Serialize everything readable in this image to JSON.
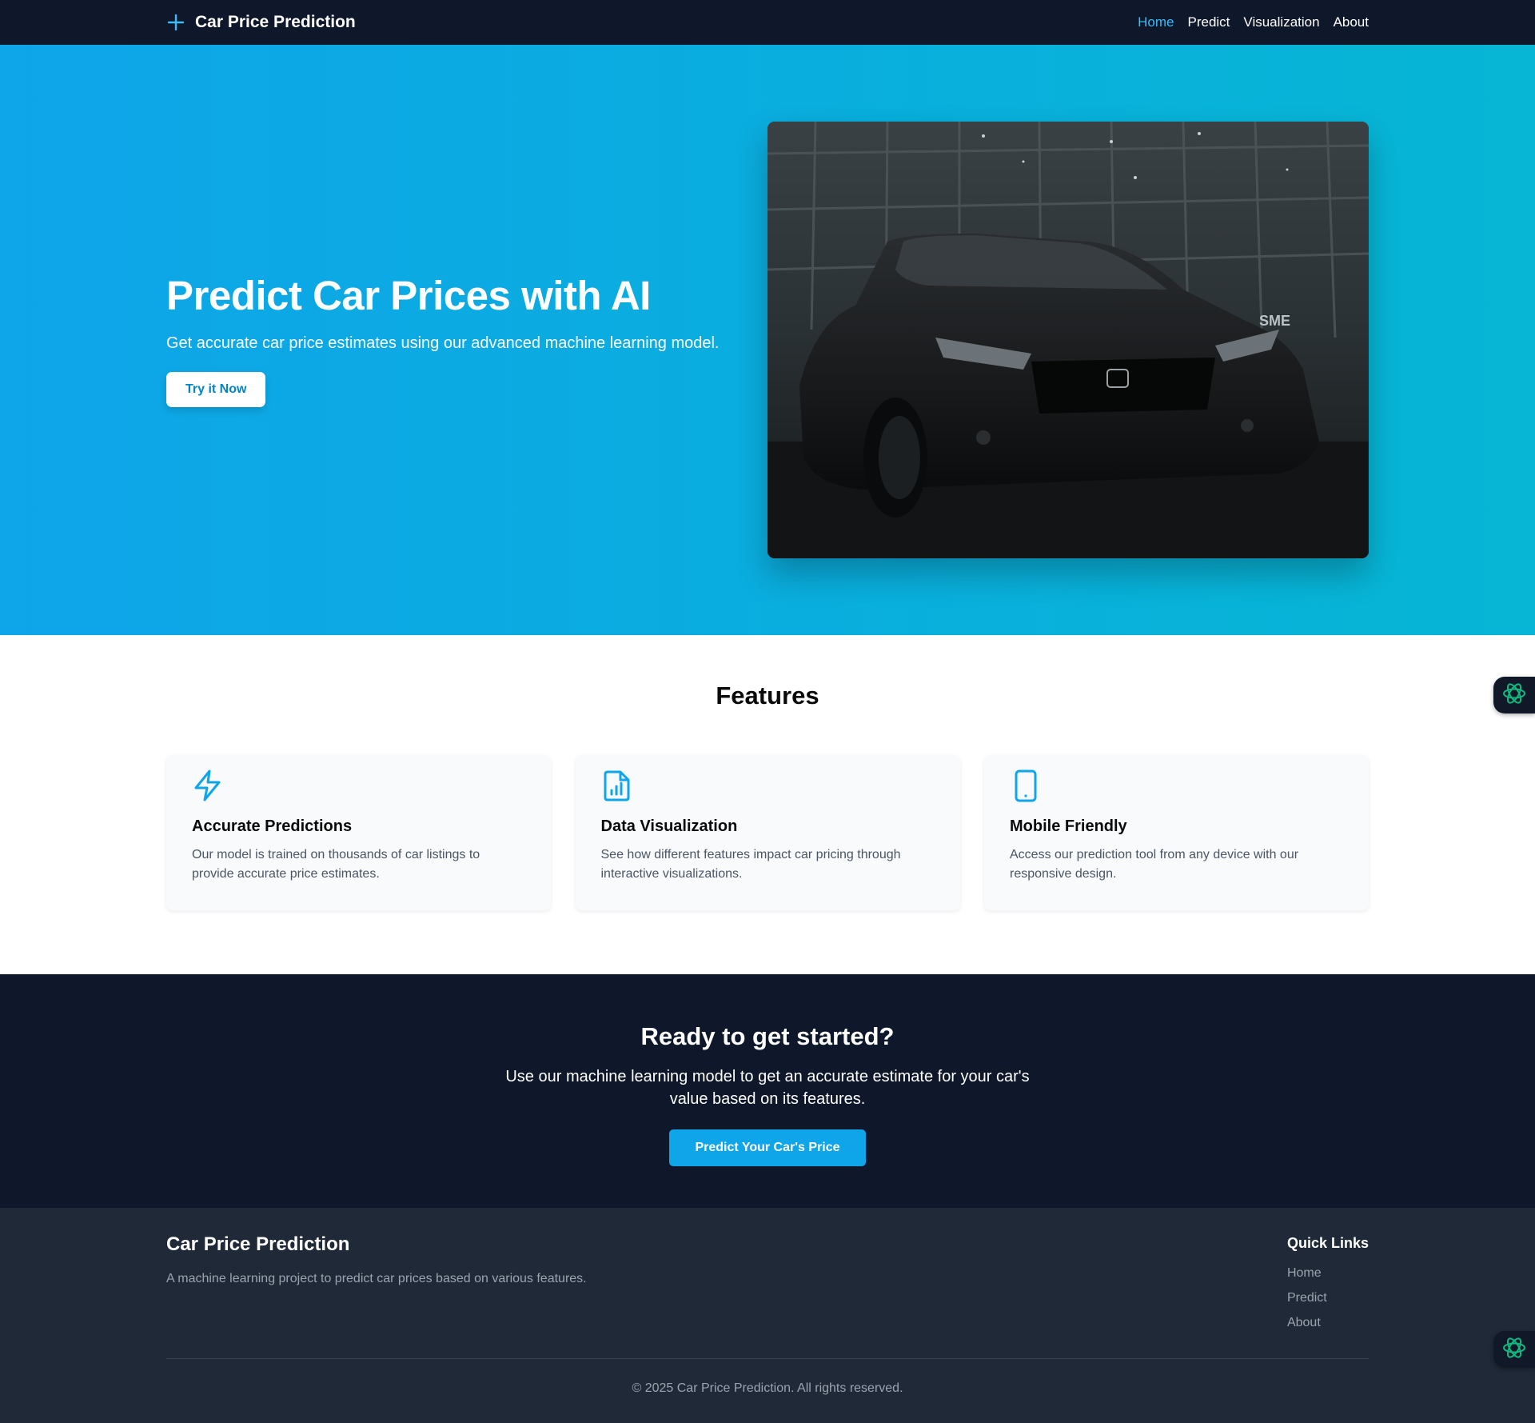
{
  "navbar": {
    "brand": "Car Price Prediction",
    "brand_icon": "plus-icon",
    "links": [
      {
        "label": "Home",
        "active": true
      },
      {
        "label": "Predict",
        "active": false
      },
      {
        "label": "Visualization",
        "active": false
      },
      {
        "label": "About",
        "active": false
      }
    ]
  },
  "hero": {
    "title": "Predict Car Prices with AI",
    "subtitle": "Get accurate car price estimates using our advanced machine learning model.",
    "button": "Try it Now",
    "image": "black sedan car photo"
  },
  "features": {
    "title": "Features",
    "cards": [
      {
        "icon": "lightning-icon",
        "title": "Accurate Predictions",
        "description": "Our model is trained on thousands of car listings to provide accurate price estimates."
      },
      {
        "icon": "chart-file-icon",
        "title": "Data Visualization",
        "description": "See how different features impact car pricing through interactive visualizations."
      },
      {
        "icon": "mobile-icon",
        "title": "Mobile Friendly",
        "description": "Access our prediction tool from any device with our responsive design."
      }
    ]
  },
  "cta": {
    "title": "Ready to get started?",
    "text": "Use our machine learning model to get an accurate estimate for your car's value based on its features.",
    "button": "Predict Your Car's Price"
  },
  "footer": {
    "brand": "Car Price Prediction",
    "description": "A machine learning project to predict car prices based on various features.",
    "quick_links_title": "Quick Links",
    "quick_links": [
      "Home",
      "Predict",
      "About"
    ],
    "copyright": "© 2025 Car Price Prediction. All rights reserved."
  },
  "widgets": {
    "icon": "ai-assistant-icon"
  },
  "colors": {
    "accent": "#0ea5e9",
    "navbar_bg": "#0f172a",
    "footer_bg": "#1f2937",
    "widget_icon": "#10b981"
  }
}
